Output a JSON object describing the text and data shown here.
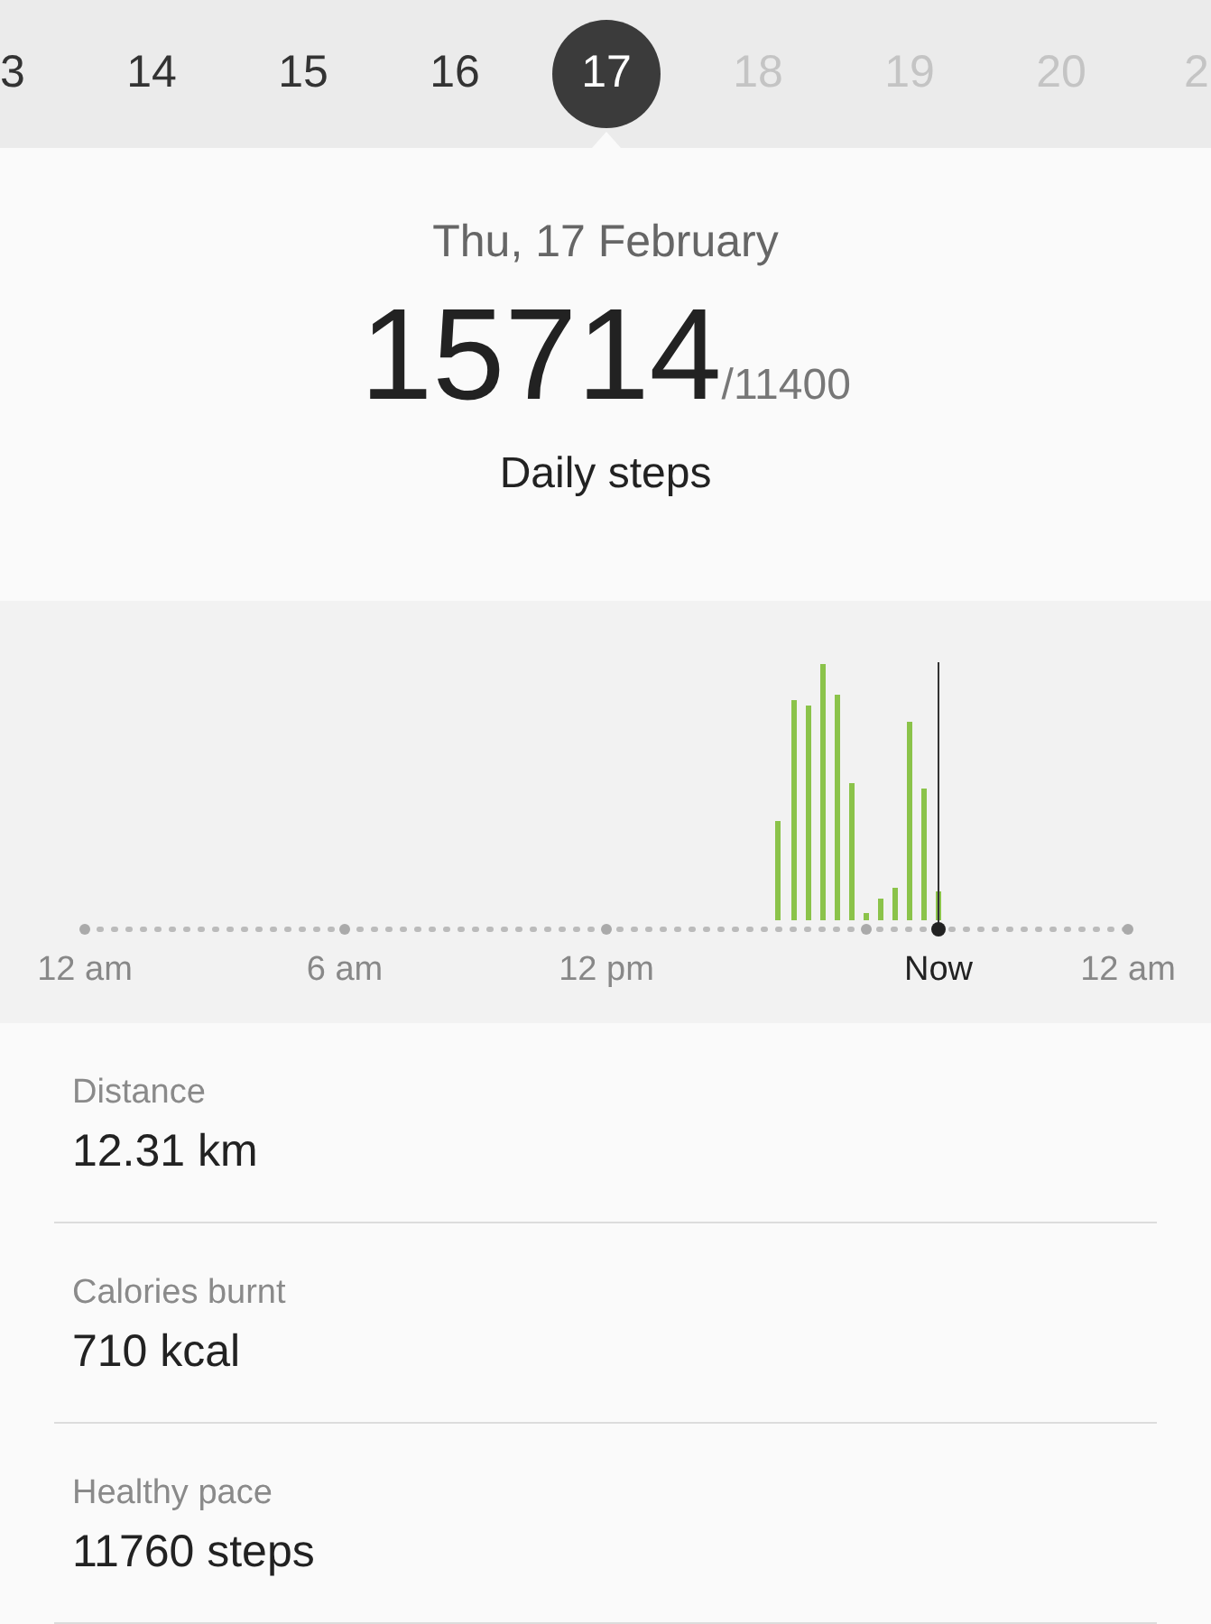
{
  "dates": [
    {
      "label": "3",
      "selected": false,
      "disabled": false
    },
    {
      "label": "14",
      "selected": false,
      "disabled": false
    },
    {
      "label": "15",
      "selected": false,
      "disabled": false
    },
    {
      "label": "16",
      "selected": false,
      "disabled": false
    },
    {
      "label": "17",
      "selected": true,
      "disabled": false
    },
    {
      "label": "18",
      "selected": false,
      "disabled": true
    },
    {
      "label": "19",
      "selected": false,
      "disabled": true
    },
    {
      "label": "20",
      "selected": false,
      "disabled": true
    },
    {
      "label": "2",
      "selected": false,
      "disabled": true
    }
  ],
  "summary": {
    "date": "Thu, 17 February",
    "steps": "15714",
    "goal": "/11400",
    "label": "Daily steps"
  },
  "chart": {
    "axis_labels": [
      {
        "label": "12 am",
        "kind": "time"
      },
      {
        "label": "6 am",
        "kind": "time"
      },
      {
        "label": "12 pm",
        "kind": "time"
      },
      {
        "label": "Now",
        "kind": "now"
      },
      {
        "label": "12 am",
        "kind": "time"
      }
    ]
  },
  "stats": [
    {
      "label": "Distance",
      "value": "12.31 km"
    },
    {
      "label": "Calories burnt",
      "value": "710 kcal"
    },
    {
      "label": "Healthy pace",
      "value": "11760 steps"
    }
  ]
}
